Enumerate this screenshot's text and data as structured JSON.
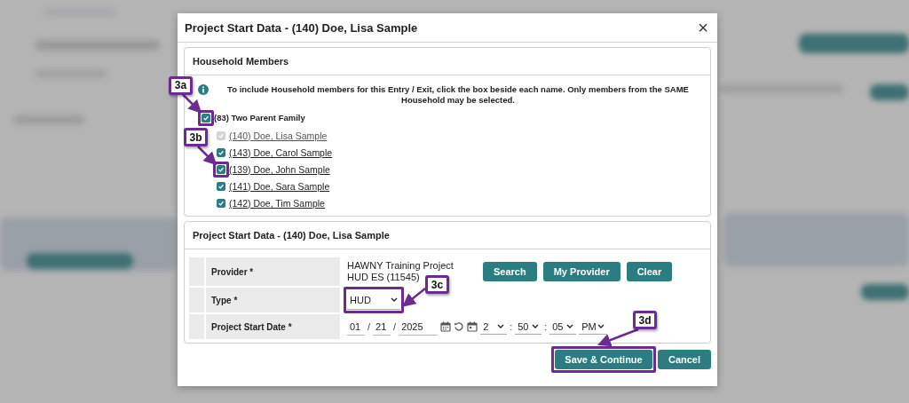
{
  "dialog": {
    "title": "Project Start Data - (140) Doe, Lisa Sample",
    "close": "×"
  },
  "household": {
    "heading": "Household Members",
    "info": "To include Household members for this Entry / Exit, click the box beside each name. Only members from the SAME Household may be selected.",
    "group": {
      "label": "(83) Two Parent Family",
      "checked": true,
      "disabled": false,
      "callout": "3a"
    },
    "members": [
      {
        "label": "(140) Doe, Lisa Sample",
        "checked": true,
        "disabled": true
      },
      {
        "label": "(143) Doe, Carol Sample",
        "checked": true,
        "disabled": false
      },
      {
        "label": "(139) Doe, John Sample",
        "checked": true,
        "disabled": false,
        "callout": "3b"
      },
      {
        "label": "(141) Doe, Sara Sample",
        "checked": true,
        "disabled": false
      },
      {
        "label": "(142) Doe, Tim Sample",
        "checked": true,
        "disabled": false
      }
    ]
  },
  "project_start": {
    "heading": "Project Start Data - (140) Doe, Lisa Sample",
    "provider": {
      "label": "Provider *",
      "value": "HAWNY Training Project HUD ES (11545)",
      "buttons": [
        "Search",
        "My Provider",
        "Clear"
      ]
    },
    "type": {
      "label": "Type *",
      "value": "HUD",
      "callout": "3c"
    },
    "start_date": {
      "label": "Project Start Date *",
      "month": "01",
      "day": "21",
      "year": "2025",
      "hour": "2",
      "minute": "50",
      "second": "05",
      "ampm": "PM",
      "separators": [
        "/",
        "/",
        ":",
        ":"
      ]
    }
  },
  "footer_buttons": [
    {
      "label": "Save & Continue",
      "callout": "3d"
    },
    {
      "label": "Cancel"
    }
  ]
}
